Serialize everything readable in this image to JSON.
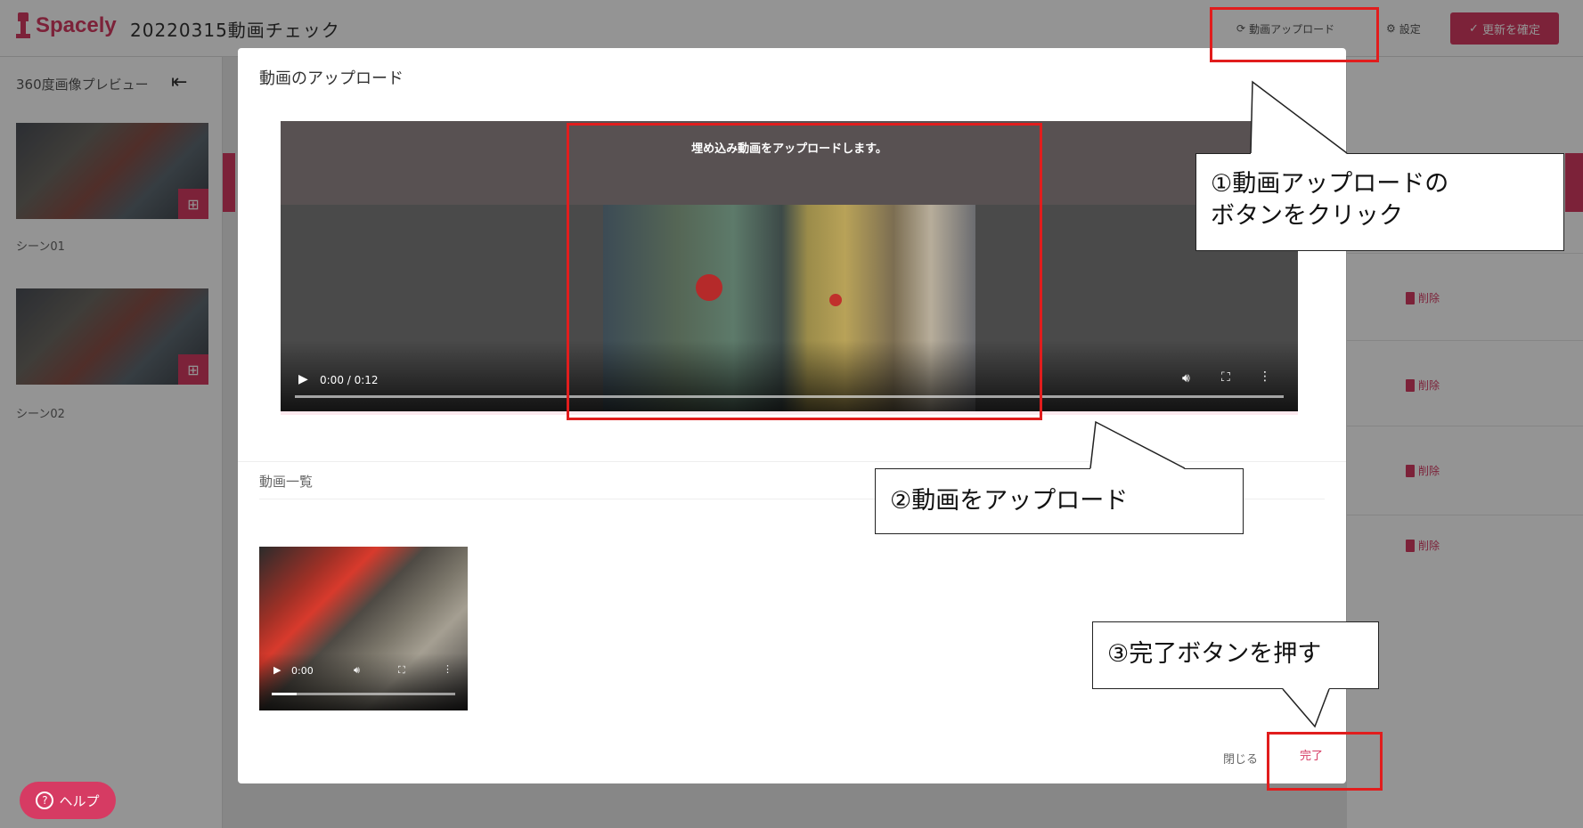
{
  "app": {
    "logo_text": "Spacely",
    "page_title": "20220315動画チェック",
    "brand_color": "#d63b63"
  },
  "toolbar": {
    "upload_label": "動画アップロード",
    "settings_label": "設定",
    "confirm_label": "更新を確定"
  },
  "sidebar": {
    "title": "360度画像プレビュー",
    "scenes": [
      {
        "label": "シーン01"
      },
      {
        "label": "シーン02"
      }
    ]
  },
  "right_panel": {
    "delete_label": "削除"
  },
  "help": {
    "label": "ヘルプ"
  },
  "modal": {
    "title": "動画のアップロード",
    "upload_banner": "埋め込み動画をアップロードします。",
    "player": {
      "time": "0:00 / 0:12"
    },
    "list_title": "動画一覧",
    "list_item": {
      "time": "0:00"
    },
    "close_label": "閉じる",
    "done_label": "完了"
  },
  "annotations": [
    {
      "text_line1": "①動画アップロードの",
      "text_line2": "ボタンをクリック"
    },
    {
      "text_line1": "②動画をアップロード"
    },
    {
      "text_line1": "③完了ボタンを押す"
    }
  ],
  "icons": {
    "upload": "upload-icon",
    "settings": "gear-icon",
    "confirm": "check-icon",
    "collapse": "collapse-left-icon",
    "delete": "trash-icon",
    "help": "question-icon",
    "play": "play-icon",
    "volume": "volume-icon",
    "fullscreen": "fullscreen-icon",
    "more": "more-vertical-icon"
  }
}
